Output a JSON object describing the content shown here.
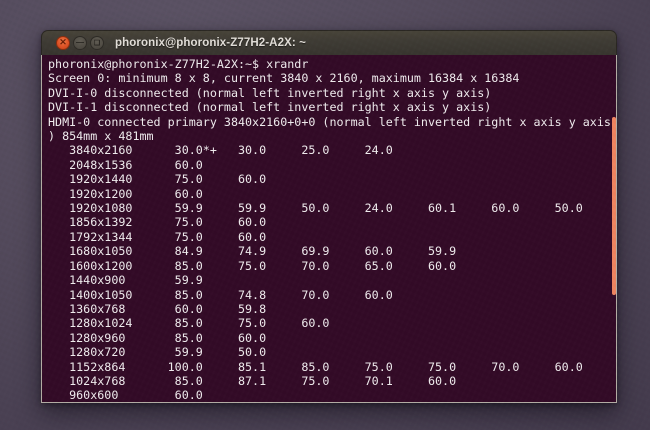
{
  "window": {
    "title": "phoronix@phoronix-Z77H2-A2X: ~",
    "controls": {
      "close_glyph": "✕",
      "minimize_glyph": "—",
      "maximize_glyph": "❑"
    }
  },
  "terminal": {
    "columns": 80,
    "command": "xrandr",
    "lines": [
      "phoronix@phoronix-Z77H2-A2X:~$ xrandr",
      "Screen 0: minimum 8 x 8, current 3840 x 2160, maximum 16384 x 16384",
      "DVI-I-0 disconnected (normal left inverted right x axis y axis)",
      "DVI-I-1 disconnected (normal left inverted right x axis y axis)",
      "HDMI-0 connected primary 3840x2160+0+0 (normal left inverted right x axis y axis",
      ") 854mm x 481mm",
      "   3840x2160      30.0*+   30.0     25.0     24.0",
      "   2048x1536      60.0",
      "   1920x1440      75.0     60.0",
      "   1920x1200      60.0",
      "   1920x1080      59.9     59.9     50.0     24.0     60.1     60.0     50.0",
      "   1856x1392      75.0     60.0",
      "   1792x1344      75.0     60.0",
      "   1680x1050      84.9     74.9     69.9     60.0     59.9",
      "   1600x1200      85.0     75.0     70.0     65.0     60.0",
      "   1440x900       59.9",
      "   1400x1050      85.0     74.8     70.0     60.0",
      "   1360x768       60.0     59.8",
      "   1280x1024      85.0     75.0     60.0",
      "   1280x960       85.0     60.0",
      "   1280x720       59.9     50.0",
      "   1152x864      100.0     85.1     85.0     75.0     75.0     70.0     60.0",
      "   1024x768       85.0     87.1     75.0     70.1     60.0",
      "   960x600        60.0"
    ]
  },
  "colors": {
    "terminal_background": "#330b27",
    "terminal_text": "#f0ecee",
    "titlebar_background": "#3f3c35",
    "close_button": "#df5226",
    "scrollbar_thumb": "#ef8460",
    "desktop_purple": "#544b5d"
  }
}
